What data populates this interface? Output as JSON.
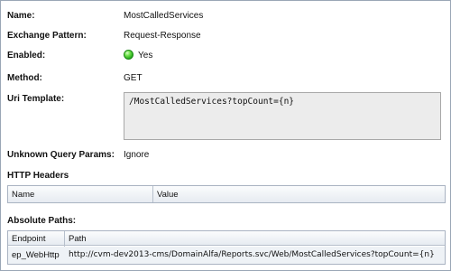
{
  "fields": {
    "name_label": "Name:",
    "name_value": "MostCalledServices",
    "exchange_label": "Exchange Pattern:",
    "exchange_value": "Request-Response",
    "enabled_label": "Enabled:",
    "enabled_value": "Yes",
    "method_label": "Method:",
    "method_value": "GET",
    "uri_label": "Uri Template:",
    "uri_value": "/MostCalledServices?topCount={n}",
    "unknown_label": "Unknown Query Params:",
    "unknown_value": "Ignore"
  },
  "http_headers": {
    "title": "HTTP Headers",
    "columns": [
      "Name",
      "Value"
    ]
  },
  "absolute_paths": {
    "title": "Absolute Paths:",
    "columns": [
      "Endpoint",
      "Path"
    ],
    "rows": [
      {
        "endpoint": "ep_WebHttp",
        "path": "http://cvm-dev2013-cms/DomainAlfa/Reports.svc/Web/MostCalledServices?topCount={n}"
      }
    ]
  },
  "colors": {
    "enabled_indicator": "#2fbf22",
    "grid_header": "#e6ebf1",
    "selected_row": "#eef2f6"
  },
  "icons": {
    "enabled_indicator": "green-status-dot-icon"
  }
}
